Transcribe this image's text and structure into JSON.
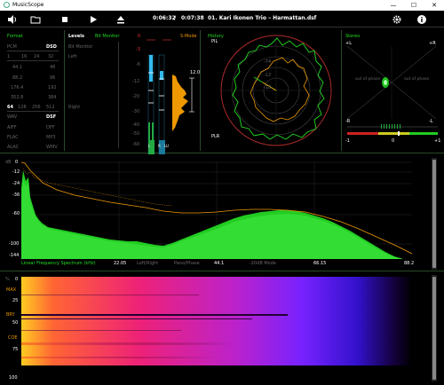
{
  "window": {
    "title": "MusicScope",
    "minimize": "—",
    "maximize": "☐",
    "close": "✕"
  },
  "toolbar": {
    "time_elapsed": "0:06:32",
    "time_sep": "/",
    "time_total": "0:07:38",
    "track_title": "01. Kari Ikonen Trio – Harmattan.dsf"
  },
  "format": {
    "title": "Format",
    "pcm": "PCM",
    "dsd": "DSD",
    "bits": [
      "1",
      "16",
      "24",
      "32"
    ],
    "rates_left": [
      "44.1",
      "88.2",
      "176.4",
      "352.8"
    ],
    "rates_right": [
      "48",
      "96",
      "192",
      "384"
    ],
    "dsd_rates": [
      "64",
      "128",
      "256",
      "512"
    ],
    "types_left": [
      "WAV",
      "AIFF",
      "FLAC",
      "ALAC"
    ],
    "types_right": [
      "DSF",
      "DFF",
      "MP3",
      "WMV"
    ]
  },
  "levels": {
    "title": "Levels",
    "mode": "Bit Monitor",
    "bit_monitor": "Bit Monitor",
    "left": "Left",
    "right": "Right",
    "db_marks": [
      "0",
      "-3",
      "-6",
      "-12",
      "-20",
      "-30",
      "-40",
      "-50",
      "-60"
    ],
    "peak_value": "12.0",
    "smode": "S-Mode",
    "lr_labels": [
      "L",
      "R",
      "LU"
    ],
    "level_left": 0.28,
    "level_right": 0.38
  },
  "history": {
    "title": "History",
    "pil": "PIL",
    "plr": "PLR",
    "rings": [
      "-74",
      "-12",
      "-18"
    ]
  },
  "stereo": {
    "title": "Stereo",
    "plus_l": "+L",
    "plus_r": "+R",
    "minus_l": "-L",
    "minus_r": "-R",
    "out_of_phase": "out of phase",
    "corr_min": "-1",
    "corr_mid": "0",
    "corr_max": "+1",
    "correlation": 0.55
  },
  "spectrum": {
    "db_unit": "dB",
    "db_ticks": [
      "0",
      "-12",
      "-24",
      "-36",
      "-60",
      "-100",
      "-144"
    ],
    "caption": "Linear Frequency Spectrum (kHz)",
    "tabs": [
      "Left/Right",
      "Pano/Phase",
      "-20dB Mode"
    ],
    "freq_ticks": [
      "22.05",
      "44.1",
      "66.15",
      "88.2"
    ]
  },
  "spectrogram": {
    "unit": "%",
    "y_ticks": [
      "0",
      "25",
      "50",
      "75",
      "100"
    ],
    "labels": [
      "MAX",
      "BRY",
      "COE"
    ]
  },
  "colors": {
    "green": "#22dd22",
    "orange": "#ee9900",
    "red": "#ee3333",
    "blue": "#33bbee"
  }
}
